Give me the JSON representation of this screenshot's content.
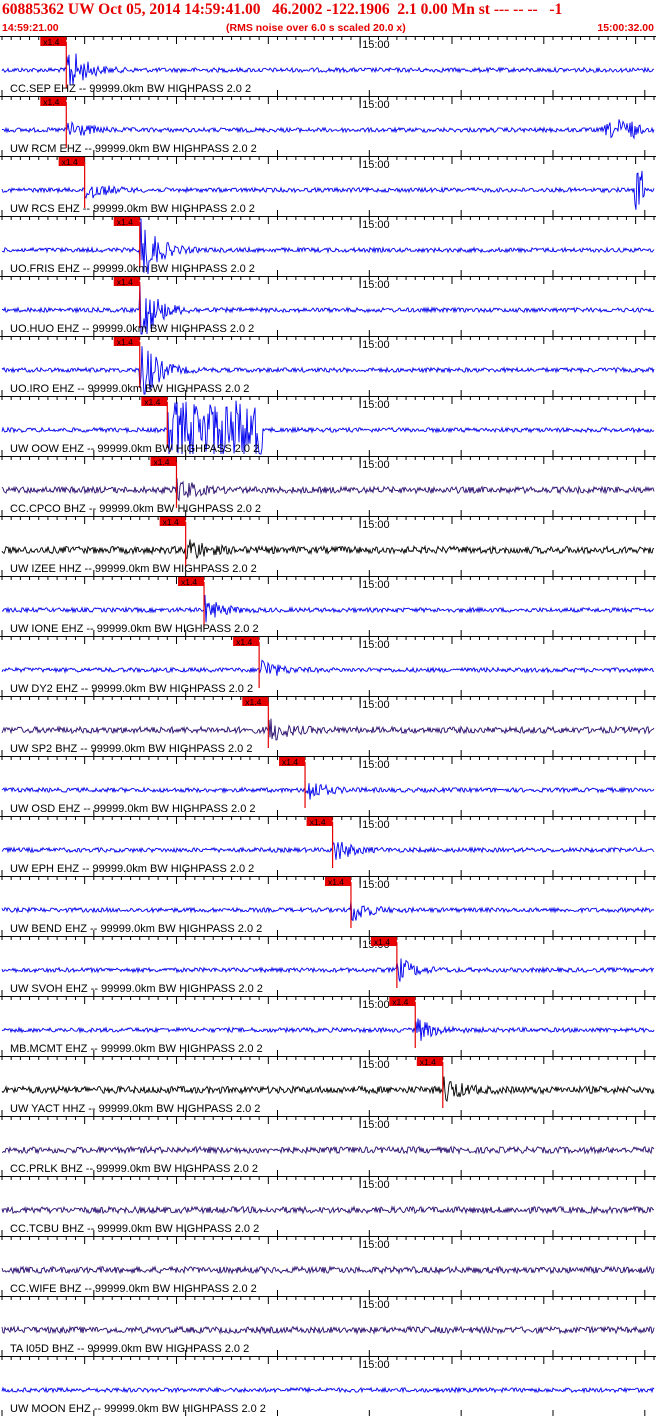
{
  "header": {
    "title": "60885362 UW Oct 05, 2014 14:59:41.00   46.2002 -122.1906  2.1 0.00 Mn st --- -- --   -1",
    "start_time": "14:59:21.00",
    "noise_note": "(RMS noise over 6.0 s scaled 20.0 x)",
    "end_time": "15:00:32.00"
  },
  "time_marker_label": "15:00",
  "pick_label": "x1.4",
  "colors": {
    "header": "#e60000",
    "blue": "#0000ee",
    "black": "#000000",
    "purple": "#2a0e6e",
    "pick": "#e60000"
  },
  "traces": [
    {
      "label": "CC.SEP EHZ -- 99999.0km BW  HIGHPASS  2.0  2",
      "color": "blue",
      "pick_time": "14:59:28.00",
      "note": "emergent large onset"
    },
    {
      "label": "UW RCM EHZ -- 99999.0km BW  HIGHPASS  2.0  2",
      "color": "blue",
      "pick_time": "14:59:28.00",
      "note": "burst near end"
    },
    {
      "label": "UW RCS EHZ -- 99999.0km BW  HIGHPASS  2.0  2",
      "color": "blue",
      "pick_time": "14:59:30.00",
      "note": "spike near end"
    },
    {
      "label": "UO.FRIS EHZ -- 99999.0km BW  HIGHPASS  2.0  2",
      "color": "blue",
      "pick_time": "14:59:36.00",
      "note": "clipped"
    },
    {
      "label": "UO.HUO EHZ -- 99999.0km BW  HIGHPASS  2.0  2",
      "color": "blue",
      "pick_time": "14:59:36.00",
      "note": "clipped"
    },
    {
      "label": "UO.IRO EHZ -- 99999.0km BW  HIGHPASS  2.0  2",
      "color": "blue",
      "pick_time": "14:59:36.00",
      "note": "clipped"
    },
    {
      "label": "UW OOW EHZ -- 99999.0km BW  HIGHPASS  2.0  2",
      "color": "blue",
      "pick_time": "14:59:39.00",
      "note": "saturated"
    },
    {
      "label": "CC.CPCO BHZ -- 99999.0km BW  HIGHPASS  2.0  2",
      "color": "purple",
      "pick_time": "14:59:40.00",
      "note": ""
    },
    {
      "label": "UW IZEE HHZ -- 99999.0km BW  HIGHPASS  2.0  2",
      "color": "black",
      "pick_time": "14:59:41.00",
      "note": ""
    },
    {
      "label": "UW IONE EHZ -- 99999.0km BW  HIGHPASS  2.0  2",
      "color": "blue",
      "pick_time": "14:59:43.00",
      "note": ""
    },
    {
      "label": "UW DY2 EHZ -- 99999.0km BW  HIGHPASS  2.0  2",
      "color": "blue",
      "pick_time": "14:59:49.00",
      "note": ""
    },
    {
      "label": "UW SP2 BHZ -- 99999.0km BW  HIGHPASS  2.0  2",
      "color": "purple",
      "pick_time": "14:59:50.00",
      "note": ""
    },
    {
      "label": "UW OSD EHZ -- 99999.0km BW  HIGHPASS  2.0  2",
      "color": "blue",
      "pick_time": "14:59:54.00",
      "note": ""
    },
    {
      "label": "UW EPH EHZ -- 99999.0km BW  HIGHPASS  2.0  2",
      "color": "blue",
      "pick_time": "14:59:57.00",
      "note": ""
    },
    {
      "label": "UW BEND EHZ -- 99999.0km BW  HIGHPASS  2.0  2",
      "color": "blue",
      "pick_time": "14:59:59.00",
      "note": ""
    },
    {
      "label": "UW SVOH EHZ -- 99999.0km BW  HIGHPASS  2.0  2",
      "color": "blue",
      "pick_time": "15:00:04.00",
      "note": ""
    },
    {
      "label": "MB.MCMT EHZ -- 99999.0km BW  HIGHPASS  2.0  2",
      "color": "blue",
      "pick_time": "15:00:06.00",
      "note": ""
    },
    {
      "label": "UW YACT HHZ -- 99999.0km BW  HIGHPASS  2.0  2",
      "color": "black",
      "pick_time": "15:00:09.00",
      "note": ""
    },
    {
      "label": "CC.PRLK BHZ -- 99999.0km BW  HIGHPASS  2.0  2",
      "color": "purple",
      "pick_time": "",
      "note": ""
    },
    {
      "label": "CC.TCBU BHZ -- 99999.0km BW  HIGHPASS  2.0  2",
      "color": "purple",
      "pick_time": "",
      "note": ""
    },
    {
      "label": "CC.WIFE BHZ -- 99999.0km BW  HIGHPASS  2.0  2",
      "color": "purple",
      "pick_time": "",
      "note": ""
    },
    {
      "label": "TA I05D BHZ -- 99999.0km BW  HIGHPASS  2.0  2",
      "color": "purple",
      "pick_time": "",
      "note": ""
    },
    {
      "label": "UW MOON EHZ -- 99999.0km BW  HIGHPASS  2.0  2",
      "color": "blue",
      "pick_time": "",
      "note": ""
    }
  ]
}
